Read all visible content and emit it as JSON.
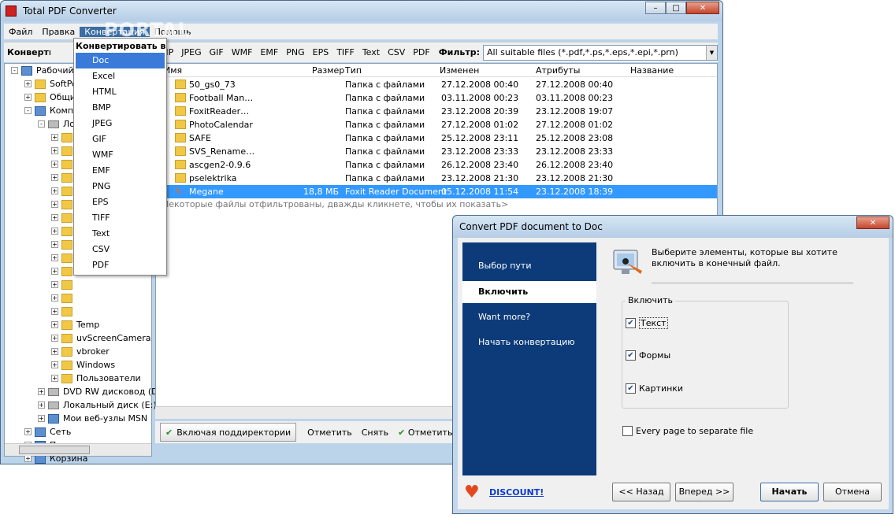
{
  "main": {
    "title": "Total PDF Converter",
    "menu": [
      "Файл",
      "Правка",
      "Конвертация",
      "Помощь"
    ],
    "watermark": "PORTAL",
    "toolbar_label": "Конвертировать",
    "formats": [
      "BMP",
      "JPEG",
      "GIF",
      "WMF",
      "EMF",
      "PNG",
      "EPS",
      "TIFF",
      "Text",
      "CSV",
      "PDF"
    ],
    "filter_label": "Фильтр:",
    "filter_value": "All suitable files (*.pdf,*.ps,*.eps,*.epi,*.prn)"
  },
  "tree": [
    {
      "label": "Рабочий стол",
      "indent": 0,
      "exp": "-",
      "icon": "desktop-icon"
    },
    {
      "label": "SoftPortal",
      "indent": 1,
      "exp": "+",
      "icon": "folder-icon"
    },
    {
      "label": "Общие",
      "indent": 1,
      "exp": "+",
      "icon": "folder-icon"
    },
    {
      "label": "Компьютер",
      "indent": 1,
      "exp": "-",
      "icon": "computer-icon"
    },
    {
      "label": "Локальный диск (C:)",
      "indent": 2,
      "exp": "-",
      "icon": "drive-icon"
    },
    {
      "label": "",
      "indent": 3,
      "exp": "+",
      "icon": "folder-icon"
    },
    {
      "label": "",
      "indent": 3,
      "exp": "+",
      "icon": "folder-icon"
    },
    {
      "label": "",
      "indent": 3,
      "exp": "+",
      "icon": "folder-icon"
    },
    {
      "label": "",
      "indent": 3,
      "exp": "+",
      "icon": "folder-icon"
    },
    {
      "label": "",
      "indent": 3,
      "exp": "+",
      "icon": "folder-icon"
    },
    {
      "label": "",
      "indent": 3,
      "exp": "+",
      "icon": "folder-icon"
    },
    {
      "label": "",
      "indent": 3,
      "exp": "+",
      "icon": "folder-icon"
    },
    {
      "label": "",
      "indent": 3,
      "exp": "+",
      "icon": "folder-icon"
    },
    {
      "label": "",
      "indent": 3,
      "exp": "+",
      "icon": "folder-icon"
    },
    {
      "label": "",
      "indent": 3,
      "exp": "+",
      "icon": "folder-icon"
    },
    {
      "label": "",
      "indent": 3,
      "exp": "+",
      "icon": "folder-icon"
    },
    {
      "label": "",
      "indent": 3,
      "exp": "+",
      "icon": "folder-icon"
    },
    {
      "label": "",
      "indent": 3,
      "exp": "+",
      "icon": "folder-icon"
    },
    {
      "label": "",
      "indent": 3,
      "exp": "+",
      "icon": "folder-icon"
    },
    {
      "label": "Temp",
      "indent": 3,
      "exp": "+",
      "icon": "folder-icon"
    },
    {
      "label": "uvScreenCamera",
      "indent": 3,
      "exp": "+",
      "icon": "folder-icon"
    },
    {
      "label": "vbroker",
      "indent": 3,
      "exp": "+",
      "icon": "folder-icon"
    },
    {
      "label": "Windows",
      "indent": 3,
      "exp": "+",
      "icon": "folder-icon"
    },
    {
      "label": "Пользователи",
      "indent": 3,
      "exp": "+",
      "icon": "folder-icon"
    },
    {
      "label": "DVD RW дисковод (D:",
      "indent": 2,
      "exp": "+",
      "icon": "dvd-icon"
    },
    {
      "label": "Локальный диск (E:)",
      "indent": 2,
      "exp": "+",
      "icon": "drive-icon"
    },
    {
      "label": "Мои веб-узлы MSN",
      "indent": 2,
      "exp": "+",
      "icon": "msn-icon"
    },
    {
      "label": "Сеть",
      "indent": 1,
      "exp": "+",
      "icon": "network-icon"
    },
    {
      "label": "Панель управления",
      "indent": 1,
      "exp": "+",
      "icon": "control-panel-icon"
    },
    {
      "label": "Корзина",
      "indent": 1,
      "exp": "+",
      "icon": "recycle-bin-icon"
    }
  ],
  "files": {
    "headers": [
      "Имя",
      "Размер",
      "Тип",
      "Изменен",
      "Атрибуты",
      "Название"
    ],
    "rows": [
      {
        "name": "50_gs0_73",
        "size": "",
        "type": "Папка с файлами",
        "modified": "27.12.2008 00:40",
        "attr": "27.12.2008 00:40"
      },
      {
        "name": "Football Man…",
        "size": "",
        "type": "Папка с файлами",
        "modified": "03.11.2008 00:23",
        "attr": "03.11.2008 00:23"
      },
      {
        "name": "FoxitReader…",
        "size": "",
        "type": "Папка с файлами",
        "modified": "23.12.2008 20:39",
        "attr": "23.12.2008 19:07"
      },
      {
        "name": "PhotoCalendar",
        "size": "",
        "type": "Папка с файлами",
        "modified": "27.12.2008 01:02",
        "attr": "27.12.2008 01:02"
      },
      {
        "name": "SAFE",
        "size": "",
        "type": "Папка с файлами",
        "modified": "25.12.2008 23:11",
        "attr": "25.12.2008 23:08"
      },
      {
        "name": "SVS_Rename…",
        "size": "",
        "type": "Папка с файлами",
        "modified": "23.12.2008 23:33",
        "attr": "23.12.2008 23:33"
      },
      {
        "name": "ascgen2-0.9.6",
        "size": "",
        "type": "Папка с файлами",
        "modified": "26.12.2008 23:40",
        "attr": "26.12.2008 23:40"
      },
      {
        "name": "pselektrika",
        "size": "",
        "type": "Папка с файлами",
        "modified": "23.12.2008 21:30",
        "attr": "23.12.2008 21:30"
      },
      {
        "name": "Megane",
        "size": "18,8 МБ",
        "type": "Foxit Reader Document",
        "modified": "05.12.2008 11:54",
        "attr": "23.12.2008 18:39"
      }
    ],
    "note": "Некоторые файлы отфильтрованы, дважды кликнете, чтобы их показать>"
  },
  "bottom": {
    "include_sub": "Включая поддиректории",
    "mark": "Отметить",
    "unmark": "Снять",
    "mark2": "Отметить"
  },
  "dropdown": {
    "header": "Конвертировать в:",
    "items": [
      "Doc",
      "Excel",
      "HTML",
      "BMP",
      "JPEG",
      "GIF",
      "WMF",
      "EMF",
      "PNG",
      "EPS",
      "TIFF",
      "Text",
      "CSV",
      "PDF"
    ]
  },
  "dialog": {
    "title": "Convert PDF document to Doc",
    "side": [
      "Выбор пути",
      "Включить",
      "Want more?",
      "Начать конвертацию"
    ],
    "desc": "Выберите элементы, которые вы  хотите включить в конечный файл.",
    "group": "Включить",
    "options": [
      {
        "label": "Текст",
        "checked": true
      },
      {
        "label": "Формы",
        "checked": true
      },
      {
        "label": "Картинки",
        "checked": true
      }
    ],
    "every_page": "Every page to separate file",
    "discount": "DISCOUNT!",
    "back": "<< Назад",
    "next": "Вперед >>",
    "start": "Начать",
    "cancel": "Отмена"
  }
}
